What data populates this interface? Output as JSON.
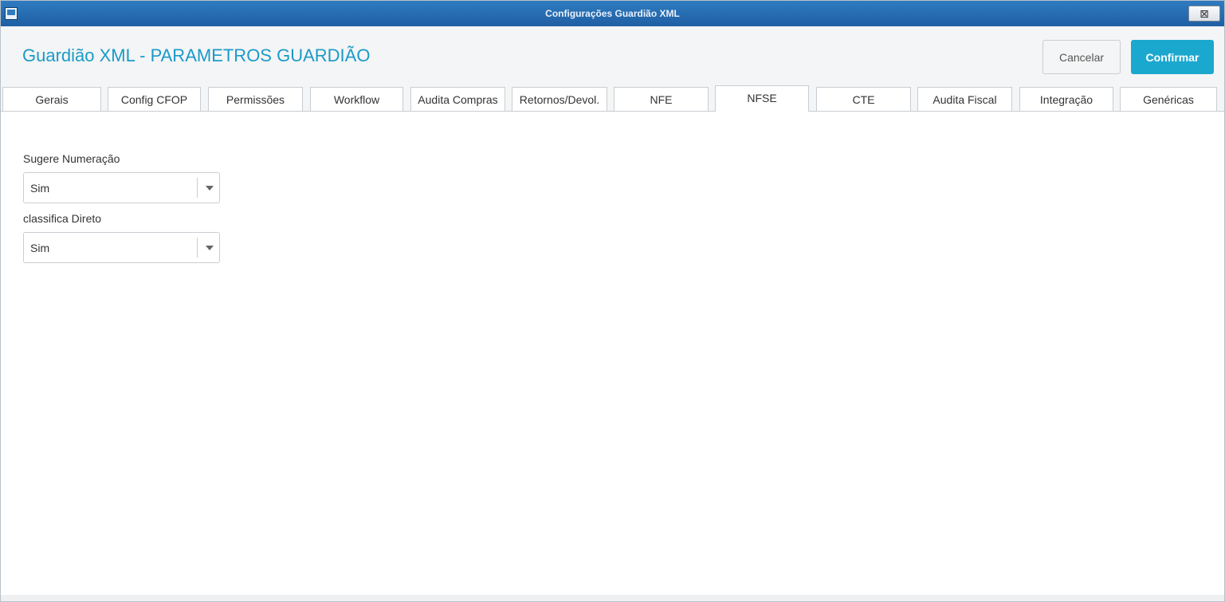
{
  "window": {
    "title": "Configurações Guardião XML",
    "close_glyph": "⊠"
  },
  "header": {
    "title": "Guardião XML - PARAMETROS GUARDIÃO",
    "cancel_label": "Cancelar",
    "confirm_label": "Confirmar"
  },
  "tabs": [
    {
      "label": "Gerais"
    },
    {
      "label": "Config CFOP"
    },
    {
      "label": "Permissões"
    },
    {
      "label": "Workflow"
    },
    {
      "label": "Audita Compras"
    },
    {
      "label": "Retornos/Devol."
    },
    {
      "label": "NFE"
    },
    {
      "label": "NFSE"
    },
    {
      "label": "CTE"
    },
    {
      "label": "Audita Fiscal"
    },
    {
      "label": "Integração"
    },
    {
      "label": "Genéricas"
    }
  ],
  "active_tab": "NFSE",
  "form": {
    "sugere_numeracao": {
      "label": "Sugere Numeração",
      "value": "Sim"
    },
    "classifica_direto": {
      "label": "classifica Direto",
      "value": "Sim"
    }
  },
  "colors": {
    "accent": "#1ba8cf",
    "title": "#1a9ac8",
    "titlebar": "#2f7bc0"
  }
}
